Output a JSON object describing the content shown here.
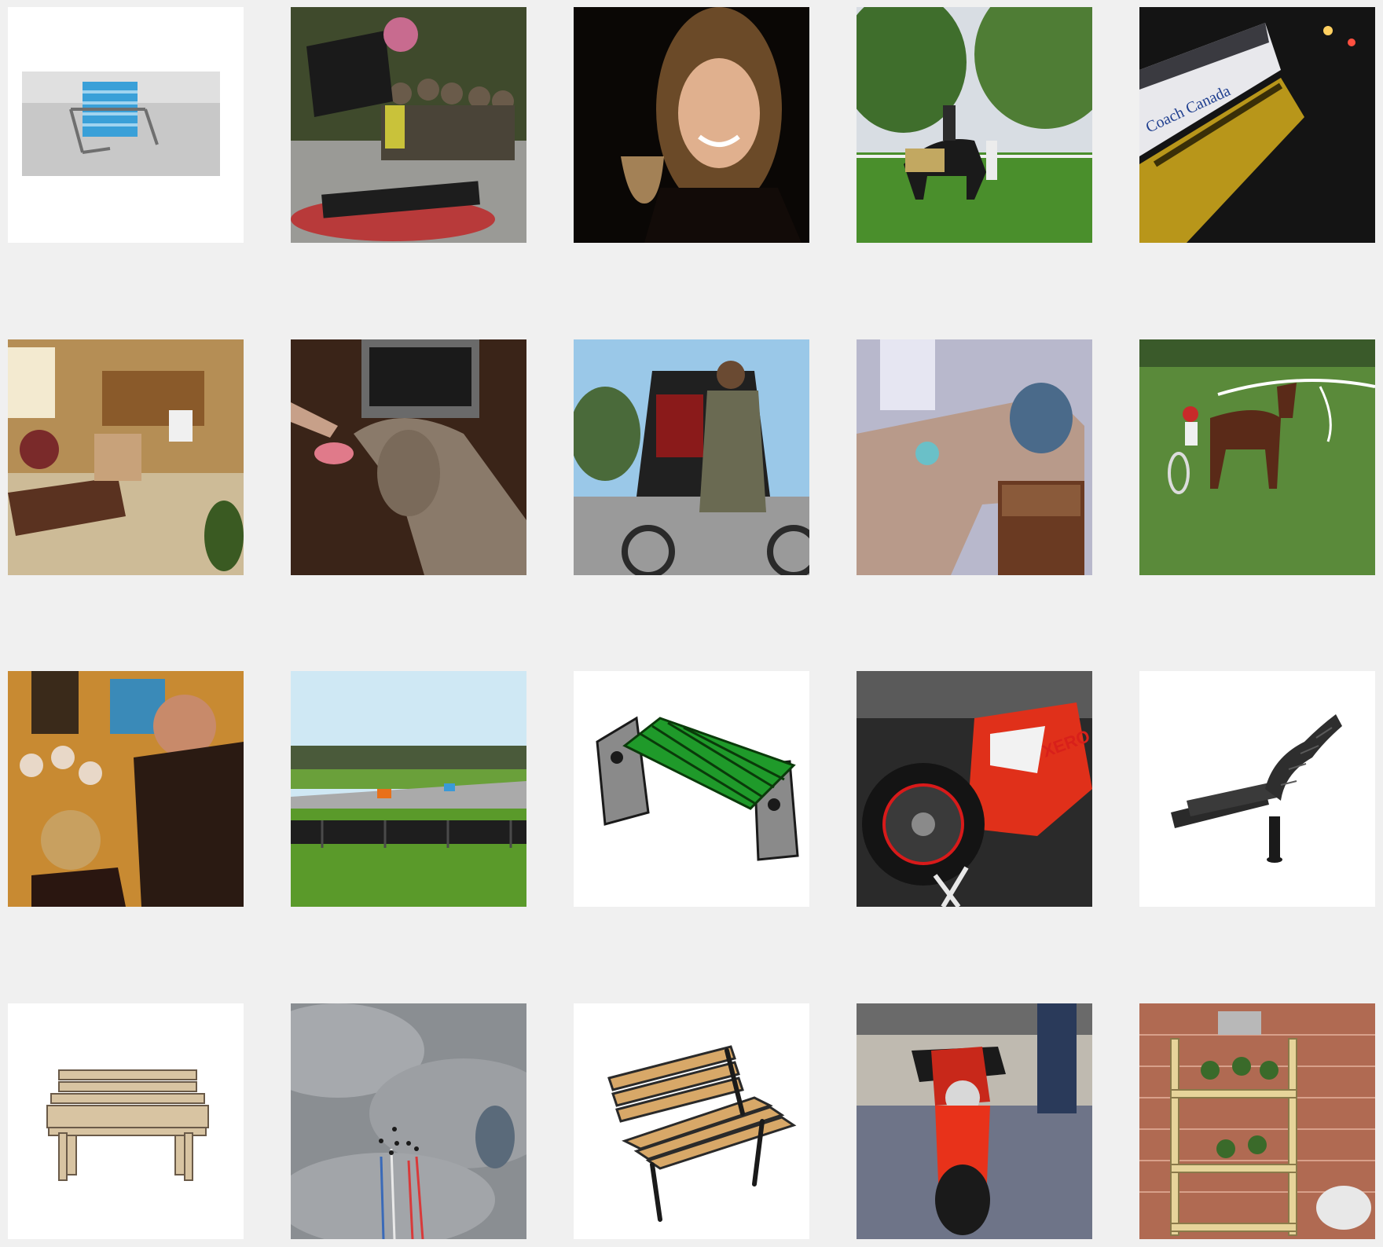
{
  "gallery": {
    "background": "#f0f0f0",
    "tiles": [
      {
        "subject": "lawn-chair",
        "text": ""
      },
      {
        "subject": "street-performance-crowd",
        "text": ""
      },
      {
        "subject": "woman-with-wine-glass",
        "text": ""
      },
      {
        "subject": "horse-rider-in-field",
        "text": ""
      },
      {
        "subject": "buses-at-night",
        "text": "Coach Canada"
      },
      {
        "subject": "living-room-kitchen",
        "text": ""
      },
      {
        "subject": "dog-licking-finger",
        "text": ""
      },
      {
        "subject": "rickshaw-driver",
        "text": ""
      },
      {
        "subject": "sectional-sofa-room",
        "text": ""
      },
      {
        "subject": "harness-racing-horse",
        "text": ""
      },
      {
        "subject": "people-in-shop",
        "text": ""
      },
      {
        "subject": "race-track-cars",
        "text": ""
      },
      {
        "subject": "green-bench-render",
        "text": ""
      },
      {
        "subject": "red-sport-motorcycle",
        "text": "XERO"
      },
      {
        "subject": "black-wavy-chair-render",
        "text": ""
      },
      {
        "subject": "wooden-bench-front-render",
        "text": ""
      },
      {
        "subject": "jets-in-cloudy-sky",
        "text": ""
      },
      {
        "subject": "wooden-park-bench-render",
        "text": ""
      },
      {
        "subject": "motorcycle-showroom",
        "text": ""
      },
      {
        "subject": "balcony-plant-shelf",
        "text": ""
      }
    ]
  }
}
